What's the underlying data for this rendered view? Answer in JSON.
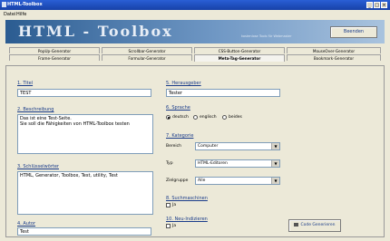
{
  "window": {
    "title": "HTML-Toolbox"
  },
  "menu": [
    "Datei",
    "Hilfe"
  ],
  "banner": {
    "logo": "HTML - Toolbox",
    "tagline": "kostenlose Tools für Webmaster"
  },
  "close_button": {
    "label": "Beenden"
  },
  "tabs": {
    "row1": [
      "PopUp-Generator",
      "Scrollbar-Generator",
      "CSS-Button-Generator",
      "MouseOver-Generator"
    ],
    "row2": [
      "Frame-Generator",
      "Formular-Generator",
      "Meta-Tag-Generator",
      "Bookmark-Generator"
    ],
    "active": "Meta-Tag-Generator"
  },
  "form": {
    "title_label": "1. Titel",
    "title_value": "TEST",
    "description_label": "2. Beschreibung",
    "description_value": "Das ist eine Test-Seite.\nSie soll die Fähigkeiten von HTML-Toolbox testen",
    "keywords_label": "3. Schlüsselwörter",
    "keywords_value": "HTML, Generator, Toolbox, Test, utility, Test",
    "author_label": "4. Autor",
    "author_value": "Test",
    "editor_label": "5. Herausgeber",
    "editor_value": "Tester",
    "language_label": "6. Sprache",
    "language_options": [
      "deutsch",
      "englisch",
      "beides"
    ],
    "language_selected": "deutsch",
    "category_label": "7. Kategorie",
    "category_rows": [
      {
        "label": "Bereich",
        "value": "Computer"
      },
      {
        "label": "Typ",
        "value": "HTML-Editoren"
      },
      {
        "label": "Zielgruppe",
        "value": "Alle"
      }
    ],
    "robots_label": "8. Suchmaschinen",
    "robots_check": "Ja",
    "reload_label": "10. Neu-Indizieren",
    "reload_check": "Ja"
  },
  "generate_button": {
    "label": "Code Generieren"
  }
}
